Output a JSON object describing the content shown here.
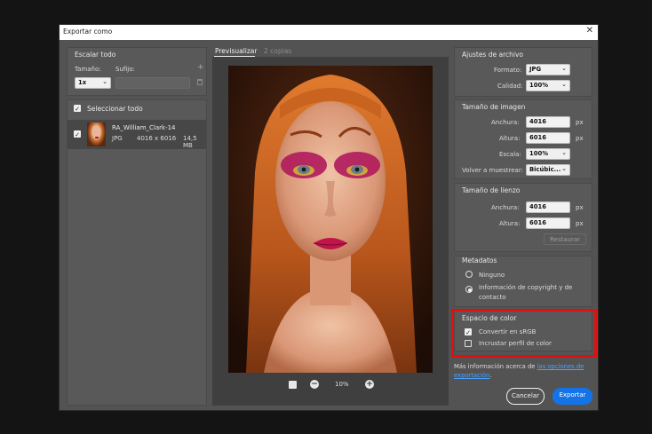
{
  "window": {
    "title": "Exportar como",
    "close_glyph": "✕"
  },
  "scale_all": {
    "header": "Escalar todo",
    "size_label": "Tamaño:",
    "suffix_label": "Sufijo:",
    "size_value": "1x",
    "suffix_value": "",
    "add_glyph": "+",
    "delete_glyph": "🗑"
  },
  "select_all": {
    "label": "Seleccionar todo",
    "checked": true
  },
  "file": {
    "name": "RA_William_Clark-14",
    "format": "JPG",
    "dimensions": "4016 x 6016",
    "size": "14,5 MB"
  },
  "tabs": [
    {
      "label": "Previsualizar",
      "active": true
    },
    {
      "label": "2 copias",
      "active": false
    }
  ],
  "zoom": {
    "value": "10%",
    "minus_glyph": "−",
    "plus_glyph": "+"
  },
  "file_settings": {
    "header": "Ajustes de archivo",
    "format_label": "Formato:",
    "format_value": "JPG",
    "quality_label": "Calidad:",
    "quality_value": "100%"
  },
  "image_size": {
    "header": "Tamaño de imagen",
    "width_label": "Anchura:",
    "width_value": "4016",
    "width_unit": "px",
    "height_label": "Altura:",
    "height_value": "6016",
    "height_unit": "px",
    "scale_label": "Escala:",
    "scale_value": "100%",
    "resample_label": "Volver a muestrear:",
    "resample_value": "Bicúbic..."
  },
  "canvas_size": {
    "header": "Tamaño de lienzo",
    "width_label": "Anchura:",
    "width_value": "4016",
    "width_unit": "px",
    "height_label": "Altura:",
    "height_value": "6016",
    "height_unit": "px",
    "restore_label": "Restaurar"
  },
  "metadata": {
    "header": "Metadatos",
    "option_none": "Ninguno",
    "option_copyright_line1": "Información de copyright y de",
    "option_copyright_line2": "contacto",
    "selected": "copyright"
  },
  "color_space": {
    "header": "Espacio de color",
    "convert_label": "Convertir en sRGB",
    "convert_checked": true,
    "embed_label": "Incrustar perfil de color",
    "embed_checked": false,
    "highlight_color": "#e01010"
  },
  "more_info": {
    "prefix": "Más información acerca de ",
    "link_line1": "las opciones de",
    "link_line2": "exportación",
    "suffix": "."
  },
  "buttons": {
    "cancel": "Cancelar",
    "export": "Exportar"
  },
  "colors": {
    "accent": "#1473e6",
    "link": "#4aa3ff",
    "dialog_bg": "#535353"
  }
}
